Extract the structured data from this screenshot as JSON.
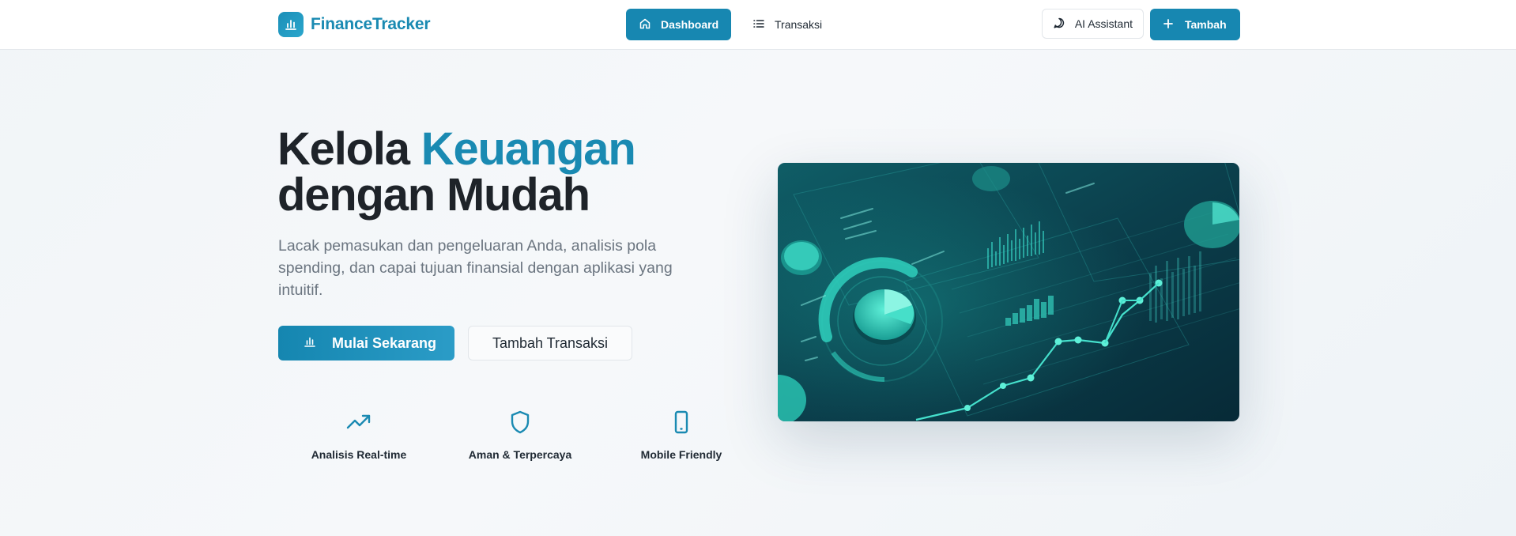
{
  "header": {
    "brand": "FinanceTracker",
    "nav": [
      {
        "label": "Dashboard",
        "active": true
      },
      {
        "label": "Transaksi",
        "active": false
      }
    ],
    "ai_label": "AI Assistant",
    "add_label": "Tambah"
  },
  "hero": {
    "title_part1": "Kelola ",
    "title_accent": "Keuangan",
    "title_part2": "dengan Mudah",
    "subtitle": "Lacak pemasukan dan pengeluaran Anda, analisis pola spending, dan capai tujuan finansial dengan aplikasi yang intuitif.",
    "primary_cta": "Mulai Sekarang",
    "secondary_cta": "Tambah Transaksi"
  },
  "features": [
    {
      "label": "Analisis Real-time",
      "icon": "trending-up-icon"
    },
    {
      "label": "Aman & Terpercaya",
      "icon": "shield-icon"
    },
    {
      "label": "Mobile Friendly",
      "icon": "smartphone-icon"
    }
  ],
  "colors": {
    "accent": "#1a8ab2",
    "primary_button": "#1787b1",
    "heading": "#1e2329",
    "muted_text": "#6b7580",
    "image_teal": "#2ec4b6"
  }
}
